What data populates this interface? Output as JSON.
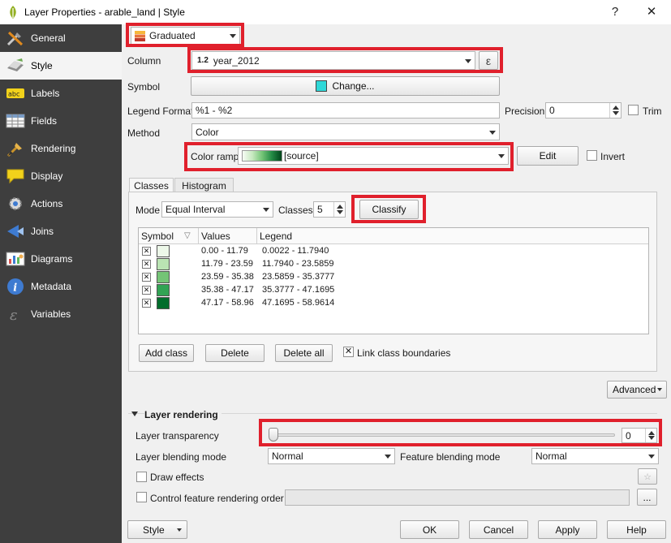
{
  "window": {
    "title": "Layer Properties - arable_land | Style",
    "help_glyph": "?",
    "close_glyph": "✕"
  },
  "sidebar": {
    "items": [
      {
        "label": "General",
        "icon": "general-icon"
      },
      {
        "label": "Style",
        "icon": "style-icon",
        "active": true
      },
      {
        "label": "Labels",
        "icon": "labels-icon"
      },
      {
        "label": "Fields",
        "icon": "fields-icon"
      },
      {
        "label": "Rendering",
        "icon": "rendering-icon"
      },
      {
        "label": "Display",
        "icon": "display-icon"
      },
      {
        "label": "Actions",
        "icon": "actions-icon"
      },
      {
        "label": "Joins",
        "icon": "joins-icon"
      },
      {
        "label": "Diagrams",
        "icon": "diagrams-icon"
      },
      {
        "label": "Metadata",
        "icon": "metadata-icon"
      },
      {
        "label": "Variables",
        "icon": "variables-icon"
      }
    ]
  },
  "renderer": {
    "value": "Graduated"
  },
  "column": {
    "label": "Column",
    "type_badge": "1.2",
    "value": "year_2012",
    "expr_glyph": "ε"
  },
  "symbol": {
    "label": "Symbol",
    "button": "Change...",
    "color": "#2fd8d8"
  },
  "legend_format": {
    "label": "Legend Format",
    "value": "%1 - %2"
  },
  "precision": {
    "label": "Precision",
    "value": "0",
    "trim_label": "Trim"
  },
  "method": {
    "label": "Method",
    "value": "Color"
  },
  "color_ramp": {
    "label": "Color ramp",
    "value": "[source]",
    "edit": "Edit",
    "invert": "Invert"
  },
  "tabs": {
    "classes": "Classes",
    "histogram": "Histogram"
  },
  "mode": {
    "label": "Mode",
    "value": "Equal Interval"
  },
  "classes": {
    "label": "Classes",
    "value": "5",
    "classify": "Classify"
  },
  "table": {
    "headers": {
      "symbol": "Symbol",
      "values": "Values",
      "legend": "Legend"
    },
    "rows": [
      {
        "values": "0.00 - 11.79",
        "legend": "0.0022 - 11.7940",
        "color": "#edf8e9"
      },
      {
        "values": "11.79 - 23.59",
        "legend": "11.7940 - 23.5859",
        "color": "#bae4b3"
      },
      {
        "values": "23.59 - 35.38",
        "legend": "23.5859 - 35.3777",
        "color": "#74c476"
      },
      {
        "values": "35.38 - 47.17",
        "legend": "35.3777 - 47.1695",
        "color": "#31a354"
      },
      {
        "values": "47.17 - 58.96",
        "legend": "47.1695 - 58.9614",
        "color": "#006d2c"
      }
    ]
  },
  "class_buttons": {
    "add": "Add class",
    "delete": "Delete",
    "delete_all": "Delete all",
    "link": "Link class boundaries"
  },
  "advanced": "Advanced",
  "layer_rendering": {
    "title": "Layer rendering",
    "transparency_label": "Layer transparency",
    "transparency_value": "0",
    "transparency_level": 0,
    "blending_label": "Layer blending mode",
    "blending_value": "Normal",
    "feature_blending_label": "Feature blending mode",
    "feature_blending_value": "Normal",
    "draw_effects": "Draw effects",
    "control_order": "Control feature rendering order",
    "ellipsis": "..."
  },
  "footer": {
    "style": "Style",
    "ok": "OK",
    "cancel": "Cancel",
    "apply": "Apply",
    "help": "Help"
  },
  "colors": {
    "highlight": "#e0202c",
    "sidebar": "#3e3e3e"
  }
}
